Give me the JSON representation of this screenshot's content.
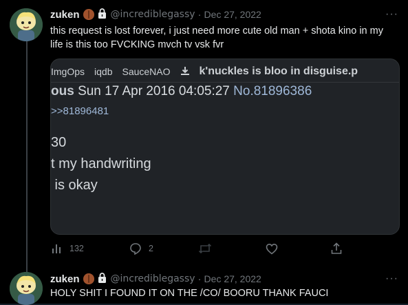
{
  "tweet1": {
    "name": "zuken",
    "handle": "@incrediblegassy",
    "separator": "·",
    "date": "Dec 27, 2022",
    "text": "this request is lost forever, i just need more cute old man + shota kino in my life is this too FVCKING mvch tv vsk fvr",
    "media": {
      "buttons": [
        "ImgOps",
        "iqdb",
        "SauceNAO"
      ],
      "title": "k'nuckles is bloo in disguise.p",
      "post_header_name": "ous",
      "post_header_datetime": "Sun 17 Apr 2016 04:05:27",
      "post_header_no": "No.81896386",
      "reply_ref": ">>81896481",
      "body_lines": [
        "30",
        "t my handwriting",
        " is okay"
      ]
    },
    "stats": {
      "views": "132",
      "replies": "2"
    },
    "more": "···"
  },
  "tweet2": {
    "name": "zuken",
    "handle": "@incrediblegassy",
    "separator": "·",
    "date": "Dec 27, 2022",
    "text": "HOLY SHIT I FOUND IT ON THE /CO/ BOORU THANK FAUCI",
    "more": "···"
  },
  "colors": {
    "background": "#000000",
    "muted": "#71767b",
    "text": "#e7e9ea",
    "link": "#9fb8d8"
  },
  "icons": [
    "chestnut-emoji",
    "lock-icon",
    "more-icon",
    "views-icon",
    "reply-icon",
    "retweet-icon",
    "like-icon",
    "share-icon",
    "download-icon"
  ]
}
